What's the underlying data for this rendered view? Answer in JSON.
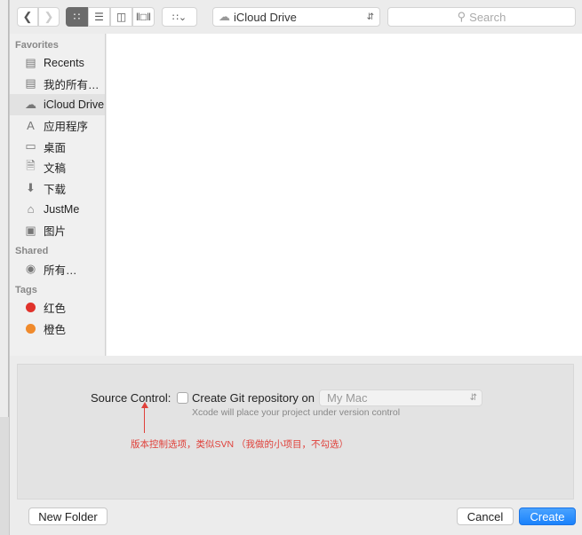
{
  "toolbar": {
    "location": "iCloud Drive",
    "search_placeholder": "Search"
  },
  "sidebar": {
    "favorites_header": "Favorites",
    "favorites": [
      {
        "label": "Recents",
        "icon": "recents-icon"
      },
      {
        "label": "我的所有…",
        "icon": "all-files-icon"
      },
      {
        "label": "iCloud Drive",
        "icon": "cloud-icon"
      },
      {
        "label": "应用程序",
        "icon": "applications-icon"
      },
      {
        "label": "桌面",
        "icon": "desktop-icon"
      },
      {
        "label": "文稿",
        "icon": "documents-icon"
      },
      {
        "label": "下载",
        "icon": "download-icon"
      },
      {
        "label": "JustMe",
        "icon": "home-icon"
      },
      {
        "label": "图片",
        "icon": "camera-icon"
      }
    ],
    "shared_header": "Shared",
    "shared": [
      {
        "label": "所有…",
        "icon": "network-icon"
      }
    ],
    "tags_header": "Tags",
    "tags": [
      {
        "label": "红色",
        "color": "#e0322b"
      },
      {
        "label": "橙色",
        "color": "#f08a2c"
      }
    ]
  },
  "options": {
    "source_control_label": "Source Control:",
    "checkbox_label": "Create Git repository on",
    "checked": false,
    "location_select": "My Mac",
    "hint": "Xcode will place your project under version control",
    "annotation": "版本控制选项，类似SVN （我做的小项目，不勾选）",
    "annotation_color": "#e0403a"
  },
  "footer": {
    "new_folder": "New Folder",
    "cancel": "Cancel",
    "create": "Create",
    "accent": "#1a82fb"
  }
}
